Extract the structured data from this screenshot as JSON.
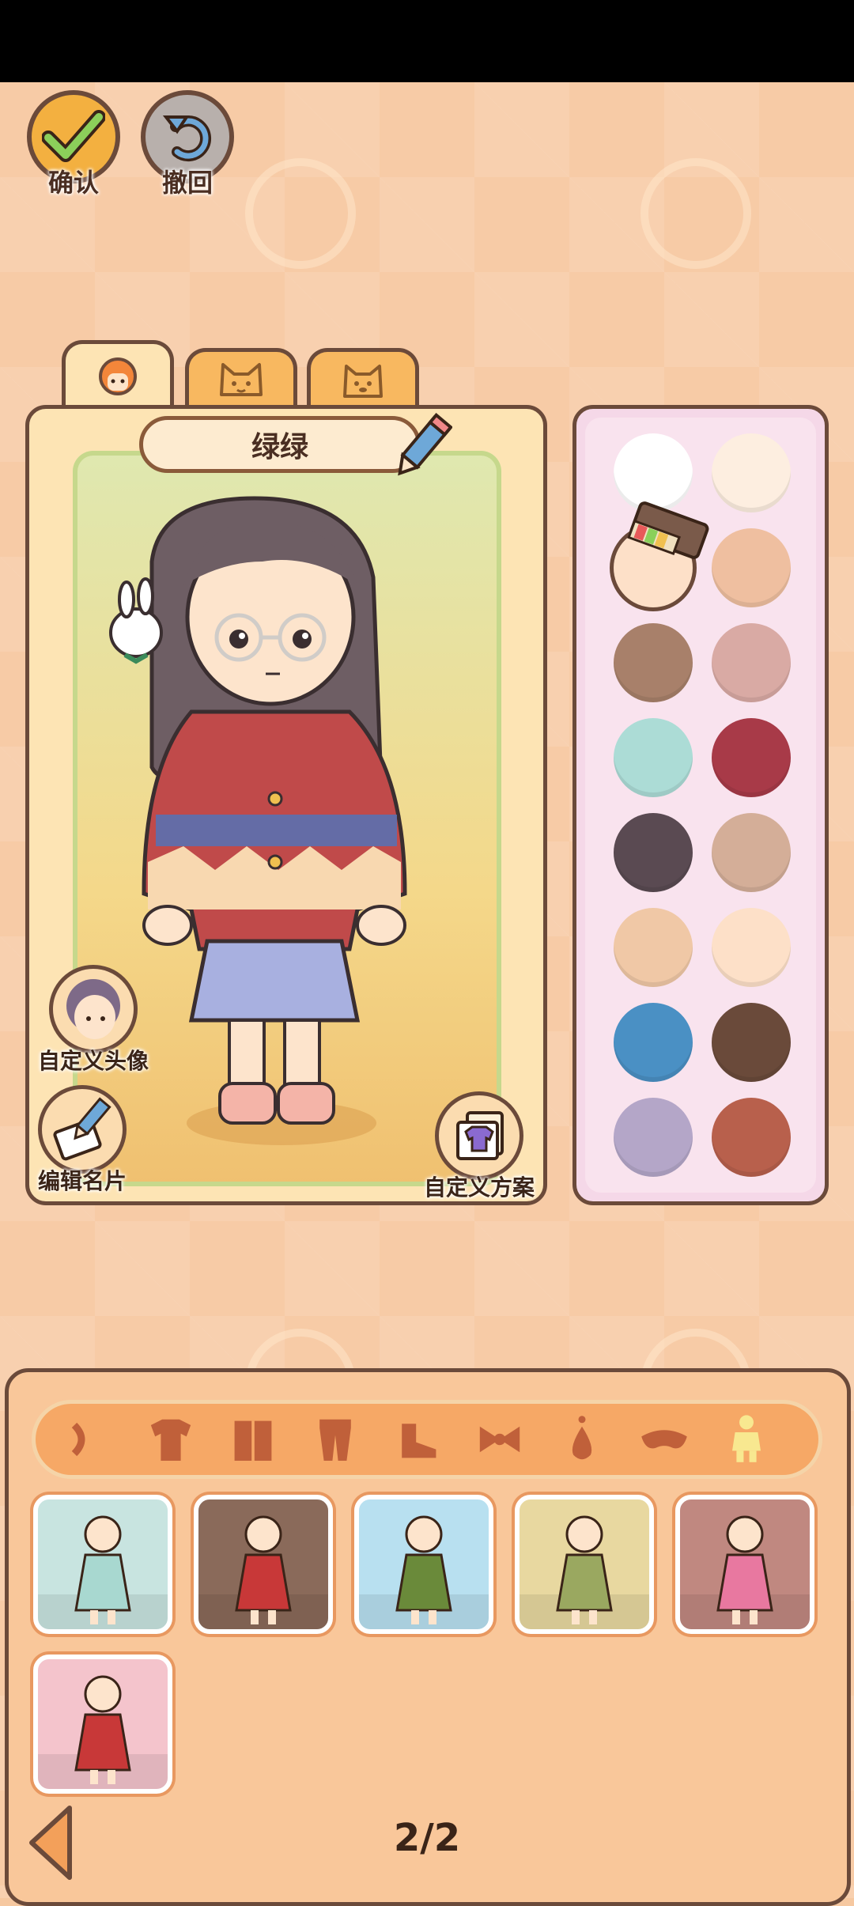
{
  "top_buttons": {
    "confirm_label": "确认",
    "undo_label": "撤回"
  },
  "character": {
    "name": "绿绿"
  },
  "side_buttons": {
    "custom_avatar": "自定义头像",
    "edit_card": "编辑名片",
    "custom_scheme": "自定义方案"
  },
  "tabs": [
    {
      "icon": "girl-face-icon",
      "active": true
    },
    {
      "icon": "cat-face-icon",
      "active": false
    },
    {
      "icon": "dog-face-icon",
      "active": false
    }
  ],
  "colors": {
    "swatches": [
      "#ffffff",
      "#fdeee0",
      "#fde0c8",
      "#efbfa0",
      "#a8806a",
      "#d9aaa4",
      "#acdcd6",
      "#a83a48",
      "#5a4a52",
      "#d4ae98",
      "#f0c8a6",
      "#fde0c8",
      "#4a90c4",
      "#6a4a3a",
      "#b4a6c8",
      "#b8604c"
    ],
    "selected_index": 2,
    "accent": "#6b4a3a"
  },
  "categories": [
    {
      "icon": "ribbon-icon",
      "active": false
    },
    {
      "icon": "tshirt-icon",
      "active": false
    },
    {
      "icon": "coat-icon",
      "active": false
    },
    {
      "icon": "pants-icon",
      "active": false
    },
    {
      "icon": "shoe-icon",
      "active": false
    },
    {
      "icon": "bow-icon",
      "active": false
    },
    {
      "icon": "earring-icon",
      "active": false
    },
    {
      "icon": "mask-icon",
      "active": false
    },
    {
      "icon": "outfit-set-icon",
      "active": true
    }
  ],
  "outfits": [
    {
      "name": "outfit-1",
      "bg": "#c8e4e0",
      "dress": "#a8d8d0"
    },
    {
      "name": "outfit-2",
      "bg": "#8a6a5a",
      "dress": "#c83838"
    },
    {
      "name": "outfit-3",
      "bg": "#b8e0f0",
      "dress": "#6a8a3a"
    },
    {
      "name": "outfit-4",
      "bg": "#e8d8a0",
      "dress": "#9aa860"
    },
    {
      "name": "outfit-5",
      "bg": "#c08880",
      "dress": "#e878a0"
    },
    {
      "name": "outfit-6",
      "bg": "#f4c4cc",
      "dress": "#c83838"
    }
  ],
  "pager": {
    "text": "2/2"
  }
}
